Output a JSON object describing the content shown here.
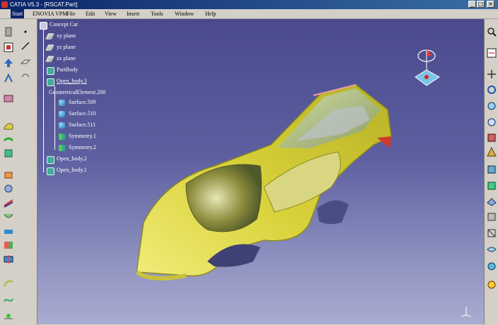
{
  "window": {
    "title": "CATIA V5.3 - [RSCAT.Part]",
    "minimize_glyph": "_",
    "maximize_glyph": "□",
    "close_glyph": "×"
  },
  "menu": {
    "items": [
      "Start",
      "ENOVIA VPM",
      "File",
      "Edit",
      "View",
      "Insert",
      "Tools",
      "Window",
      "Help"
    ],
    "active": "Start"
  },
  "tree": {
    "root": "Concept Car",
    "nodes": [
      {
        "label": "xy plane",
        "icon": "plane-icon"
      },
      {
        "label": "yz plane",
        "icon": "plane-icon"
      },
      {
        "label": "zx plane",
        "icon": "plane-icon"
      },
      {
        "label": "PartBody",
        "icon": "body-icon"
      },
      {
        "label": "Open_body.3",
        "icon": "body-icon"
      },
      {
        "label": "GeometricalElement.200",
        "icon": "none"
      },
      {
        "label": "Surface.509",
        "icon": "surface-icon"
      },
      {
        "label": "Surface.510",
        "icon": "surface-icon"
      },
      {
        "label": "Surface.511",
        "icon": "surface-icon"
      },
      {
        "label": "Symmetry.1",
        "icon": "symmetry-icon"
      },
      {
        "label": "Symmetry.2",
        "icon": "symmetry-icon"
      },
      {
        "label": "Open_body.2",
        "icon": "body-icon"
      },
      {
        "label": "Open_body.1",
        "icon": "body-icon"
      }
    ]
  },
  "viewport": {
    "model": "concept-car-surface-model",
    "model_colors": {
      "body": "#d9d23a",
      "shade": "#8c8a1e",
      "glass": "#bcc8a8",
      "highlight": "#f3f0a0"
    }
  }
}
